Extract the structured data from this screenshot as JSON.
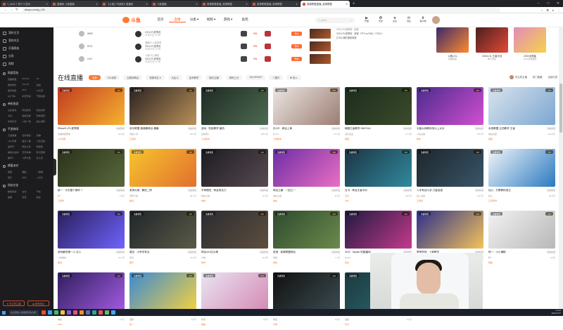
{
  "browser": {
    "tabs": [
      {
        "title": "Y_hehe Y 的个人空间",
        "active": false
      },
      {
        "title": "直播间 斗鱼直播",
        "active": false
      },
      {
        "title": "【斗鱼】叫我老K 直播间",
        "active": false
      },
      {
        "title": "斗鱼直播",
        "active": false
      },
      {
        "title": "英雄联盟直播_英雄联盟",
        "active": false
      },
      {
        "title": "英雄联盟直播_英雄联盟",
        "active": false
      },
      {
        "title": "英雄联盟直播_英雄联盟",
        "active": true
      }
    ],
    "url": "douyu.com/g_LOL",
    "new_tab": "+",
    "win_controls": [
      "–",
      "□",
      "✕"
    ]
  },
  "site": {
    "logo_text": "斗鱼",
    "nav": [
      {
        "label": "首页",
        "active": false
      },
      {
        "label": "直播",
        "active": true
      },
      {
        "label": "分类 ▾",
        "active": false
      },
      {
        "label": "视频 ▾",
        "active": false
      },
      {
        "label": "游戏 ▾",
        "active": false
      },
      {
        "label": "鱼吧",
        "active": false
      }
    ],
    "search_placeholder": "Y_hehe",
    "search_icon": "⌕",
    "tools": [
      {
        "icon": "▶",
        "label": "开播"
      },
      {
        "icon": "⏱",
        "label": "历史"
      },
      {
        "icon": "★",
        "label": "关注"
      },
      {
        "icon": "✉",
        "label": "消息"
      },
      {
        "icon": "⬇",
        "label": "客户端"
      }
    ]
  },
  "sidebar": {
    "main": [
      {
        "icon": "home",
        "label": "我的主页"
      },
      {
        "icon": "star",
        "label": "我的关注"
      },
      {
        "icon": "gift",
        "label": "开通贵族"
      },
      {
        "icon": "grid",
        "label": "分类"
      },
      {
        "icon": "video",
        "label": "视频"
      }
    ],
    "sections": [
      {
        "title": "网游竞技",
        "items": [
          "英雄联盟",
          "DOTA2",
          "CF",
          "绝地求生",
          "CS:GO",
          "逆战",
          "魔兽争霸",
          "DNF",
          "lol云顶",
          "QQ飞车",
          "炉石传说",
          "守望先锋"
        ]
      },
      {
        "title": "单机热游",
        "items": [
          "主机游戏",
          "怀旧游戏",
          "我的世界",
          "方舟",
          "使命召唤",
          "恐怖游戏",
          "永劫无间",
          "人类一败",
          "独立游戏"
        ]
      },
      {
        "title": "手游休闲",
        "items": [
          "王者荣耀",
          "和平精英",
          "原神",
          "LOL手游",
          "第五人格",
          "火影忍者",
          "金铲铲",
          "明日方舟",
          "阴阳师",
          "猫咪大战争",
          "天天象棋",
          "梦幻西游",
          "崩坏3",
          "斗罗大陆",
          "影之诗"
        ]
      },
      {
        "title": "颜值派对",
        "items": [
          "颜值",
          "舞蹈",
          "一起看",
          "音乐",
          "户外",
          "二次元"
        ]
      },
      {
        "title": "科技文化",
        "items": [
          "数码科技",
          "文化",
          "汽车",
          "鱼教",
          "科普",
          "美食"
        ]
      }
    ],
    "bottom_buttons": [
      "★ 关注的主播",
      "◆ 我的粉丝"
    ]
  },
  "schedule": [
    {
      "team": "WBG",
      "player": "",
      "match": "2021LPL夏季赛",
      "time": "07月27日 17:00",
      "status": "预约"
    },
    {
      "team": "EDG",
      "player": "直播中-斗鱼赛事",
      "match": "2021LPL夏季赛",
      "time": "07月27日 17:00",
      "status": "预约"
    },
    {
      "team": "LNG",
      "player": "斗鱼中心-解说",
      "match": "2021LPL夏季赛",
      "time": "07月27日 17:00",
      "status": "预约"
    }
  ],
  "schedule_vs": "VS",
  "news": {
    "head": "2021LPL夏季赛 · 赛程",
    "lines": [
      "2021LPL夏季赛 · 赛程 · FPX vs RNG · 0703-1",
      "[TOD] 我的退役英雄"
    ]
  },
  "promos": [
    {
      "title": "斗鱼LOL",
      "sub": "英雄联盟",
      "color1": "#3a2a6a",
      "color2": "#ff8a30"
    },
    {
      "title": "2021LOL 王者计划",
      "sub": "参与活动",
      "color1": "#4a1f1f",
      "color2": "#e44a36"
    },
    {
      "title": "2021全明星",
      "sub": "2021全明星赛",
      "color1": "#e38cb8",
      "color2": "#f6d14c"
    }
  ],
  "live": {
    "heading": "在线直播",
    "filters": [
      {
        "label": "全部",
        "on": true
      },
      {
        "label": "S11冠军",
        "on": false
      },
      {
        "label": "召唤师峡谷",
        "on": false
      },
      {
        "label": "英雄专区 ▾",
        "on": false
      },
      {
        "label": "大乱斗",
        "on": false
      },
      {
        "label": "技术教学",
        "on": false
      },
      {
        "label": "娱乐主播",
        "on": false
      },
      {
        "label": "网吧上分",
        "on": false
      },
      {
        "label": "VALORANT",
        "on": false
      },
      {
        "label": "+ 展开",
        "on": false
      },
      {
        "label": "✚ 收入",
        "on": false
      }
    ],
    "right": [
      "关注的主播",
      "热门直播",
      "全部分类"
    ],
    "cards": [
      {
        "title": "SNewS LPL夏季赛",
        "cat": "英雄联盟",
        "host": "英雄联盟赛事",
        "hot": "32.5万",
        "tag": "LPL联赛",
        "badge": "英雄联盟",
        "lvl": "300",
        "colors": [
          "#c23b21",
          "#f6b230"
        ],
        "top50": false
      },
      {
        "title": "欢乐联盟 雅典娜峡谷 暴躁",
        "cat": "英雄联盟",
        "host": "暴躁小诗",
        "hot": "98.1万",
        "tag": "王者局",
        "badge": "英雄联盟",
        "lvl": "300",
        "colors": [
          "#2a2222",
          "#b99058"
        ],
        "top50": false
      },
      {
        "title": "游戏 · 防蚊教学 最热",
        "cat": "英雄联盟",
        "host": "战地老A",
        "hot": "296.4万",
        "tag": "小白教学",
        "badge": "英雄联盟",
        "lvl": "300",
        "colors": [
          "#1f2a23",
          "#4c6a51"
        ],
        "top50": false
      },
      {
        "title": "孙少E · 峡谷上单",
        "cat": "英雄联盟",
        "host": "孙少E",
        "hot": "47.2万",
        "tag": "上单教学",
        "badge": "英雄联盟",
        "lvl": "300",
        "colors": [
          "#ece6e3",
          "#9b7d72"
        ],
        "top50": false
      },
      {
        "title": "韩服王者教学 3567314",
        "cat": "英雄联盟",
        "host": "战队出品",
        "hot": "17.2万",
        "tag": "韩服",
        "badge": "英雄联盟",
        "lvl": "300",
        "colors": [
          "#1b2c1e",
          "#3c4b2a"
        ],
        "top50": true
      },
      {
        "title": "头脑大师教你怎么上大分",
        "cat": "英雄联盟",
        "host": "斗鱼主播",
        "hot": "98.4万",
        "tag": "教学",
        "badge": "英雄联盟",
        "lvl": "300",
        "colors": [
          "#4b2b8c",
          "#d14fd0"
        ],
        "top50": true
      },
      {
        "title": "永恒联盟 云顶教学 王者",
        "cat": "英雄联盟",
        "host": "峡谷主播",
        "hot": "102.8万",
        "tag": "国服",
        "badge": "英雄联盟",
        "lvl": "300",
        "colors": [
          "#d9e3ed",
          "#7ca7d1"
        ],
        "top50": false
      },
      {
        "title": "新一 · 今天整个操作 7",
        "cat": "英雄联盟",
        "host": "新一",
        "hot": "5.6万",
        "tag": "王者局",
        "badge": "英雄联盟",
        "lvl": "300",
        "colors": [
          "#2b321c",
          "#59683a"
        ],
        "top50": false
      },
      {
        "title": "老师大咖 · 解说二阵",
        "cat": "英雄联盟",
        "host": "老师大咖",
        "hot": "86.7万",
        "tag": "解说",
        "badge": "英雄联盟",
        "lvl": "300",
        "colors": [
          "#f6c52c",
          "#e26f2f"
        ],
        "top50": false
      },
      {
        "title": "不再理性 · 峡谷的实力",
        "cat": "英雄联盟",
        "host": "峡谷之巅",
        "hot": "12.4万",
        "tag": "单排",
        "badge": "英雄联盟",
        "lvl": "300",
        "colors": [
          "#1c1c20",
          "#584a52"
        ],
        "top50": true
      },
      {
        "title": "峡谷之巅 · 一回之一",
        "cat": "英雄联盟",
        "host": "峡谷之巅",
        "hot": "8.4万",
        "tag": "峡谷",
        "badge": "英雄联盟",
        "lvl": "300",
        "colors": [
          "#6d2ea4",
          "#ea6ec4"
        ],
        "top50": true
      },
      {
        "title": "五马 · 峡谷王者冲分",
        "cat": "英雄联盟",
        "host": "五马",
        "hot": "32.6万",
        "tag": "冲分",
        "badge": "英雄联盟",
        "lvl": "300",
        "colors": [
          "#1d3443",
          "#2f8a9e"
        ],
        "top50": false
      },
      {
        "title": "人手有战斗多 力量加强",
        "cat": "英雄联盟",
        "host": "战斗主播",
        "hot": "43.7万",
        "tag": "王者局",
        "badge": "英雄联盟",
        "lvl": "300",
        "colors": [
          "#1e262b",
          "#385569"
        ],
        "top50": false
      },
      {
        "title": "仙儿 · 打野教你成王",
        "cat": "英雄联盟",
        "host": "仙儿",
        "hot": "56.9万",
        "tag": "云顶导师",
        "badge": "英雄联盟",
        "lvl": "300",
        "colors": [
          "#f1f5f8",
          "#2b7ac1"
        ],
        "top50": false
      },
      {
        "title": "游戏解说第一人 达人",
        "cat": "英雄联盟",
        "host": "斗鱼解说",
        "hot": "25.1万",
        "tag": "解说",
        "badge": "英雄联盟",
        "lvl": "300",
        "colors": [
          "#2a1f5a",
          "#6f63ff"
        ],
        "top50": true
      },
      {
        "title": "莫也 · 小吊车有点",
        "cat": "英雄联盟",
        "host": "莫也",
        "hot": "15.3万",
        "tag": "娱乐",
        "badge": "英雄联盟",
        "lvl": "300",
        "colors": [
          "#20262a",
          "#5a5a46"
        ],
        "top50": false
      },
      {
        "title": "峡谷101位大神",
        "cat": "英雄联盟",
        "host": "大神",
        "hot": "11.8万",
        "tag": "教学",
        "badge": "英雄联盟",
        "lvl": "300",
        "colors": [
          "#2a2c31",
          "#5e4e3f"
        ],
        "top50": false
      },
      {
        "title": "老炮 · 英雄联盟峡谷",
        "cat": "英雄联盟",
        "host": "老炮",
        "hot": "7.7万",
        "tag": "峡谷",
        "badge": "英雄联盟",
        "lvl": "300",
        "colors": [
          "#2f4a2d",
          "#6b8a4d"
        ],
        "top50": false
      },
      {
        "title": "XDG · Mystic 的直播间",
        "cat": "英雄联盟",
        "host": "Mystic",
        "hot": "22.4万",
        "tag": "职业",
        "badge": "英雄联盟",
        "lvl": "300",
        "colors": [
          "#1f1a3f",
          "#c43a8c"
        ],
        "top50": false
      },
      {
        "title": "蒙家导师 · 上单教学",
        "cat": "英雄联盟",
        "host": "蒙家导师",
        "hot": "33.6万",
        "tag": "上单",
        "badge": "英雄联盟",
        "lvl": "300",
        "colors": [
          "#2b2f8c",
          "#f4c35a"
        ],
        "top50": true
      },
      {
        "title": "阿一 · 小小辅助",
        "cat": "英雄联盟",
        "host": "阿一",
        "hot": "9.2万",
        "tag": "辅助",
        "badge": "英雄联盟",
        "lvl": "300",
        "colors": [
          "#f2f2f2",
          "#b8b8b8"
        ],
        "top50": false
      },
      {
        "title": "峡谷之巅首选",
        "cat": "英雄联盟",
        "host": "峡谷",
        "hot": "4.2万",
        "tag": "ADC",
        "badge": "英雄联盟",
        "lvl": "300",
        "colors": [
          "#2f1f5e",
          "#a15ae0"
        ],
        "top50": true
      },
      {
        "title": "国服第一",
        "cat": "英雄联盟",
        "host": "国服",
        "hot": "6.4万",
        "tag": "第一",
        "badge": "英雄联盟",
        "lvl": "300",
        "colors": [
          "#3b8ad4",
          "#f3d141"
        ],
        "top50": false
      },
      {
        "title": "舞者 · 跳舞",
        "cat": "英雄联盟",
        "host": "舞者",
        "hot": "3.8万",
        "tag": "舞蹈",
        "badge": "英雄联盟",
        "lvl": "300",
        "colors": [
          "#e9e4f2",
          "#d58ab5"
        ],
        "top50": false
      },
      {
        "title": "黑暗之夜",
        "cat": "英雄联盟",
        "host": "暗夜",
        "hot": "2.6万",
        "tag": "打野",
        "badge": "英雄联盟",
        "lvl": "300",
        "colors": [
          "#111",
          "#3a4a4f"
        ],
        "top50": false
      },
      {
        "title": "游戏画面",
        "cat": "英雄联盟",
        "host": "画面",
        "hot": "1.5万",
        "tag": "高分",
        "badge": "英雄联盟",
        "lvl": "300",
        "colors": [
          "#1b3a3f",
          "#2d6b73"
        ],
        "top50": false
      }
    ]
  },
  "taskbar": {
    "search": "在这里输入你要搜索的内容",
    "time": "17:02",
    "date": "2021/7/27",
    "apps": [
      "#e94f2f",
      "#3ba1f3",
      "#3bc15e",
      "#f5c141",
      "#8a5ae0",
      "#ea4c89",
      "#f28c2e",
      "#5c6bc0",
      "#26a69a",
      "#ef5350",
      "#66bb6a",
      "#42a5f5"
    ]
  }
}
